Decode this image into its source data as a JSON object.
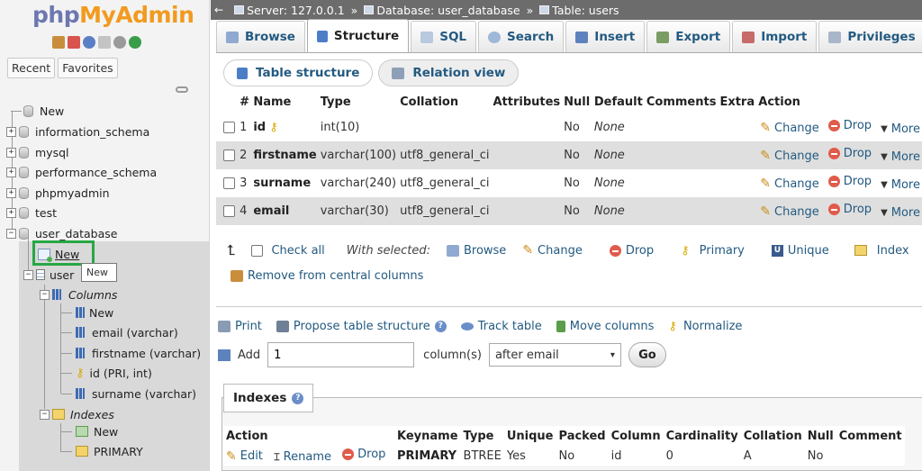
{
  "app": {
    "logo_php": "php",
    "logo_myadmin": "MyAdmin"
  },
  "nav": {
    "tabs": [
      "Recent",
      "Favorites"
    ],
    "databases": [
      "New",
      "information_schema",
      "mysql",
      "performance_schema",
      "phpmyadmin",
      "test",
      "user_database"
    ],
    "user_db": {
      "new_label": "New",
      "tooltip": "New",
      "table_label": "user",
      "columns_label": "Columns",
      "column_items": [
        "New",
        "email (varchar)",
        "firstname (varchar)",
        "id (PRI, int)",
        "surname (varchar)"
      ],
      "indexes_label": "Indexes",
      "index_items": [
        "New",
        "PRIMARY"
      ]
    }
  },
  "breadcrumb": {
    "server": "Server: 127.0.0.1",
    "database": "Database: user_database",
    "table": "Table: users"
  },
  "tabs": [
    "Browse",
    "Structure",
    "SQL",
    "Search",
    "Insert",
    "Export",
    "Import",
    "Privileges"
  ],
  "subtabs": [
    "Table structure",
    "Relation view"
  ],
  "structure": {
    "headers": [
      "#",
      "Name",
      "Type",
      "Collation",
      "Attributes",
      "Null",
      "Default",
      "Comments",
      "Extra",
      "Action"
    ],
    "rows": [
      {
        "num": "1",
        "name": "id",
        "type": "int(10)",
        "collation": "",
        "null": "No",
        "default": "None"
      },
      {
        "num": "2",
        "name": "firstname",
        "type": "varchar(100)",
        "collation": "utf8_general_ci",
        "null": "No",
        "default": "None"
      },
      {
        "num": "3",
        "name": "surname",
        "type": "varchar(240)",
        "collation": "utf8_general_ci",
        "null": "No",
        "default": "None"
      },
      {
        "num": "4",
        "name": "email",
        "type": "varchar(30)",
        "collation": "utf8_general_ci",
        "null": "No",
        "default": "None"
      }
    ],
    "actions": {
      "change": "Change",
      "drop": "Drop",
      "more": "More"
    }
  },
  "with_selected": {
    "check_all": "Check all",
    "label": "With selected:",
    "browse": "Browse",
    "change": "Change",
    "drop": "Drop",
    "primary": "Primary",
    "unique": "Unique",
    "index": "Index",
    "remove_central": "Remove from central columns"
  },
  "ops": {
    "print": "Print",
    "propose": "Propose table structure",
    "track": "Track table",
    "move": "Move columns",
    "normalize": "Normalize"
  },
  "add_columns": {
    "label": "Add",
    "value": "1",
    "unit": "column(s)",
    "position": "after email",
    "go": "Go"
  },
  "indexes": {
    "title": "Indexes",
    "headers": [
      "Action",
      "Keyname",
      "Type",
      "Unique",
      "Packed",
      "Column",
      "Cardinality",
      "Collation",
      "Null",
      "Comment"
    ],
    "row": {
      "edit": "Edit",
      "rename": "Rename",
      "drop": "Drop",
      "keyname": "PRIMARY",
      "type": "BTREE",
      "unique": "Yes",
      "packed": "No",
      "column": "id",
      "cardinality": "0",
      "collation": "A",
      "null": "No",
      "comment": ""
    }
  },
  "colors": {
    "link": "#235a81",
    "highlight": "#27a745",
    "breadcrumb_bg": "#6c6c6c"
  }
}
